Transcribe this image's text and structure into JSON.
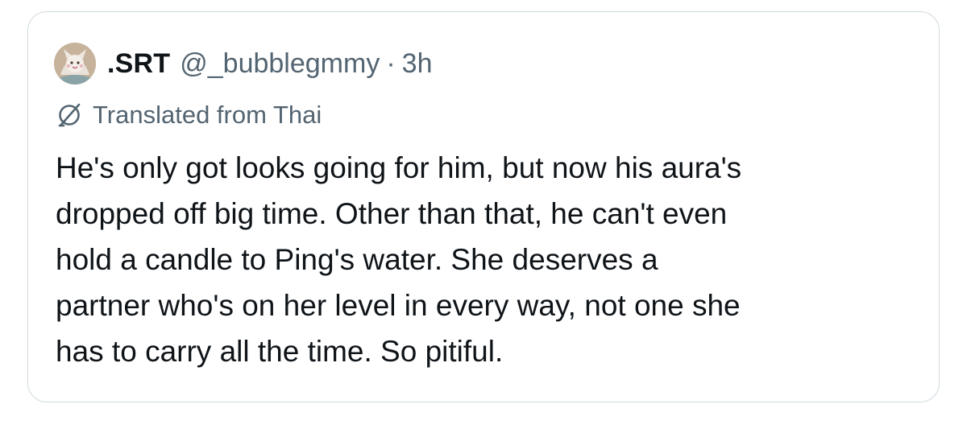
{
  "tweet": {
    "display_name": ".SRT",
    "handle": "@_bubblegmmy",
    "separator": "·",
    "time": "3h",
    "translated_label": "Translated from Thai",
    "body_lines": [
      "He's only got looks going for him, but now his aura's",
      "dropped off big time. Other than that, he can't even",
      "hold a candle to Ping's water. She deserves a",
      "partner who's on her level in every way, not one she",
      "has to carry all the time. So pitiful."
    ]
  },
  "icons": {
    "avatar": "profile-avatar",
    "translate": "translate-globe-icon"
  },
  "colors": {
    "text_primary": "#0f1419",
    "text_secondary": "#536471",
    "border": "#cfd9de",
    "avatar_bg": "#c9b8a4"
  }
}
